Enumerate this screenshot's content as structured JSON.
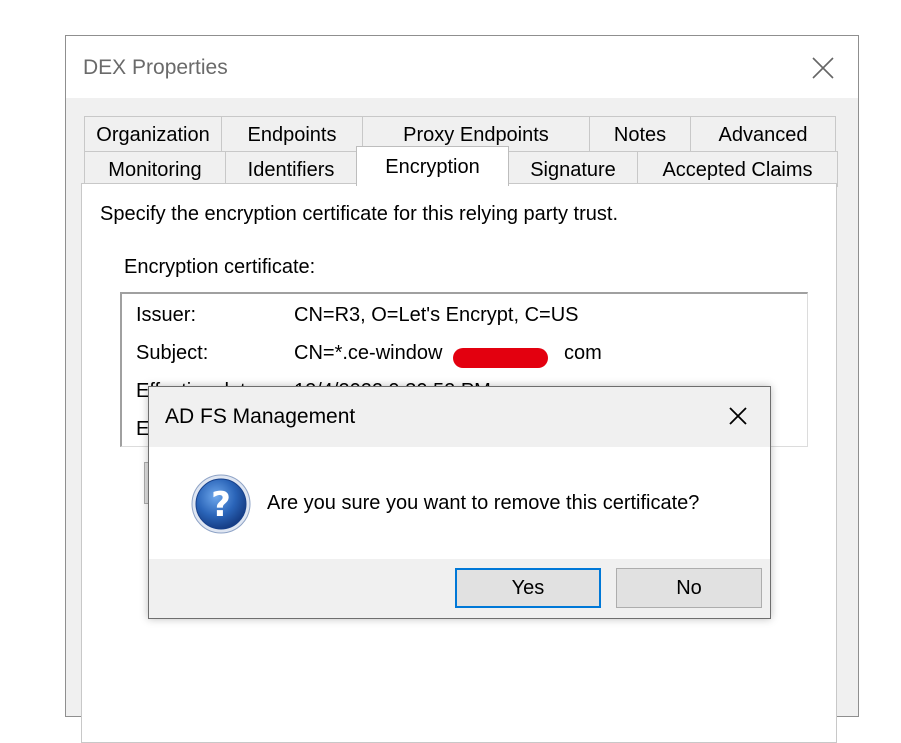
{
  "window": {
    "title": "DEX Properties"
  },
  "tabs": {
    "row1": [
      "Organization",
      "Endpoints",
      "Proxy Endpoints",
      "Notes",
      "Advanced"
    ],
    "row2": [
      "Monitoring",
      "Identifiers",
      "Encryption",
      "Signature",
      "Accepted Claims"
    ],
    "active": "Encryption"
  },
  "encryption": {
    "instruction": "Specify the encryption certificate for this relying party trust.",
    "certificate_label": "Encryption certificate:",
    "fields": [
      {
        "key": "Issuer:",
        "value": "CN=R3, O=Let's Encrypt, C=US"
      },
      {
        "key": "Subject:",
        "value": "CN=*.ce-window",
        "suffix": "com"
      },
      {
        "key": "Effective date:",
        "value": "12/4/2022 9:30:52 PM"
      },
      {
        "key": "Expiration date:",
        "value": ""
      }
    ]
  },
  "dialog": {
    "title": "AD FS Management",
    "message": "Are you sure you want to remove this certificate?",
    "yes_label": "Yes",
    "no_label": "No",
    "icon": "question-icon"
  },
  "colors": {
    "accent": "#0078d7",
    "redaction": "#e3000f",
    "icon_blue": "#1f5fb3"
  }
}
